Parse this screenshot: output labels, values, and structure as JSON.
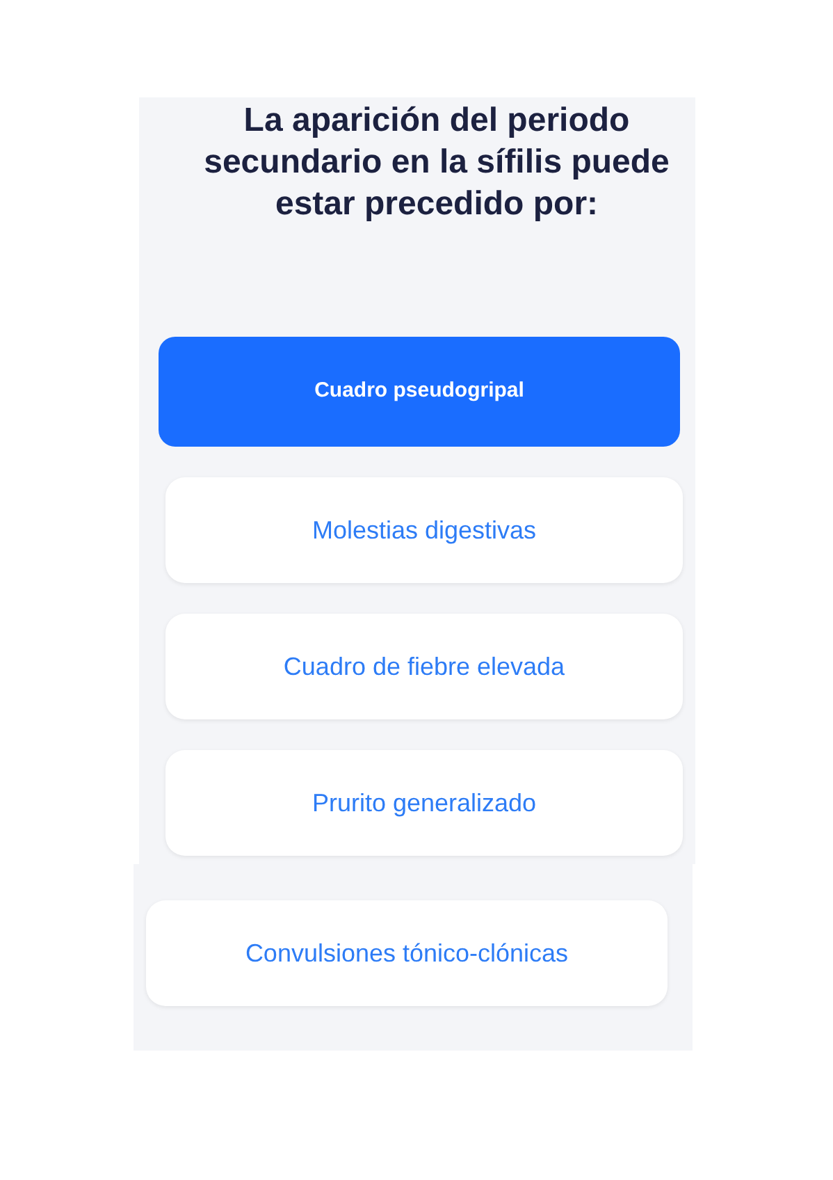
{
  "question": "La aparición del periodo secundario en la sífilis puede estar precedido por:",
  "options": [
    {
      "label": "Cuadro pseudogripal",
      "selected": true
    },
    {
      "label": "Molestias digestivas",
      "selected": false
    },
    {
      "label": "Cuadro de fiebre elevada",
      "selected": false
    },
    {
      "label": "Prurito generalizado",
      "selected": false
    }
  ],
  "lower_panel": {
    "options": [
      {
        "label": "Convulsiones tónico-clónicas",
        "selected": false
      }
    ]
  }
}
